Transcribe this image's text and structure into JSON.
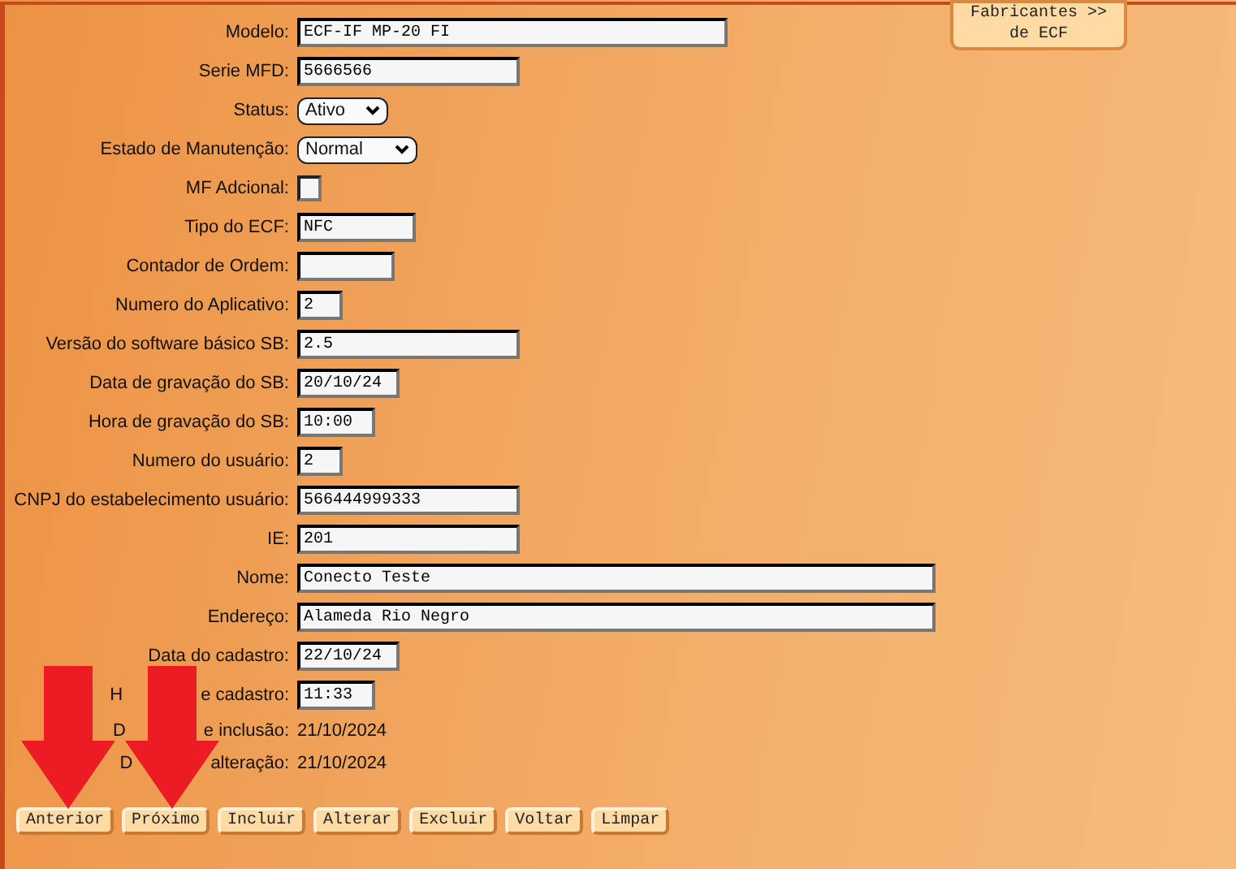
{
  "top_button": {
    "lines": [
      "Fabricantes >>",
      "de ECF"
    ]
  },
  "fields": [
    {
      "kind": "text",
      "label": [
        "Modelo:"
      ],
      "value": "ECF-IF MP-20 FI"
    },
    {
      "kind": "text",
      "label": [
        "Serie MFD:"
      ],
      "value": "5666566"
    },
    {
      "kind": "select",
      "label": [
        "Status:"
      ],
      "value": "Ativo"
    },
    {
      "kind": "select",
      "label": [
        "Estado de Manutenção:"
      ],
      "value": "Normal"
    },
    {
      "kind": "checkbox",
      "label": [
        "MF Adcional:"
      ],
      "checked": false
    },
    {
      "kind": "text",
      "label": [
        "Tipo do ECF:"
      ],
      "value": "NFC"
    },
    {
      "kind": "text",
      "label": [
        "Contador de Ordem:"
      ]
    },
    {
      "kind": "text",
      "label": [
        "Numero do Aplicativo:"
      ],
      "value": "2"
    },
    {
      "kind": "text",
      "label": [
        "Versão do software básico SB:"
      ],
      "value": "2.5"
    },
    {
      "kind": "text",
      "label": [
        "Data de gravação do SB:"
      ],
      "value": "20/10/24"
    },
    {
      "kind": "text",
      "label": [
        "Hora de gravação do SB:"
      ],
      "value": "10:00"
    },
    {
      "kind": "text",
      "label": [
        "Numero do usuário:"
      ],
      "value": "2"
    },
    {
      "kind": "text",
      "label": [
        "CNPJ do estabelecimento usuário:"
      ],
      "value": "566444999333"
    },
    {
      "kind": "text",
      "label": [
        "IE:"
      ],
      "value": "201"
    },
    {
      "kind": "text",
      "label": [
        "Nome:"
      ],
      "value": "Conecto Teste"
    },
    {
      "kind": "text",
      "label": [
        "Endereço:"
      ],
      "value": "Alameda Rio Negro"
    },
    {
      "kind": "text",
      "label": [
        "Data do cadastro:"
      ],
      "value": "22/10/24"
    },
    {
      "kind": "text",
      "label": [
        "H",
        "e cadastro:"
      ],
      "value": "11:33"
    },
    {
      "kind": "static",
      "label": [
        "D",
        "e inclusão:"
      ],
      "value": "21/10/2024"
    },
    {
      "kind": "static",
      "label": [
        "D",
        "alteração:"
      ],
      "value": "21/10/2024"
    }
  ],
  "buttons": [
    "Anterior",
    "Próximo",
    "Incluir",
    "Alterar",
    "Excluir",
    "Voltar",
    "Limpar"
  ]
}
